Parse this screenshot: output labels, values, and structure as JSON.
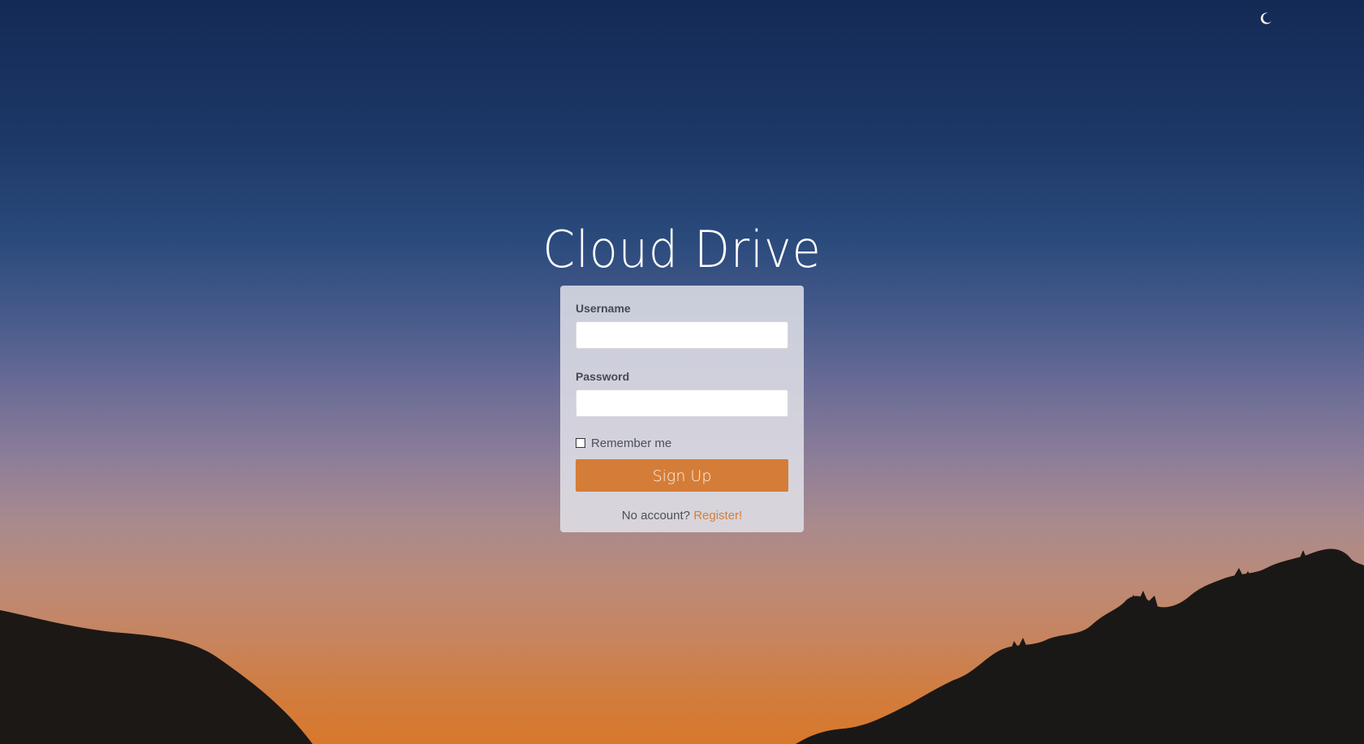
{
  "app": {
    "title": "Cloud Drive"
  },
  "login_form": {
    "username_label": "Username",
    "username_value": "",
    "password_label": "Password",
    "password_value": "",
    "remember_label": "Remember me",
    "remember_checked": false,
    "submit_label": "Sign Up",
    "footer_text": "No account?",
    "register_link": "Register!"
  },
  "colors": {
    "accent": "#d47d38",
    "panel_bg": "#e1e1e8",
    "sky_top": "#142a55",
    "sky_bottom": "#d8782c",
    "silhouette": "#1a1a1c"
  },
  "icons": {
    "moon": "crescent-moon-icon"
  }
}
